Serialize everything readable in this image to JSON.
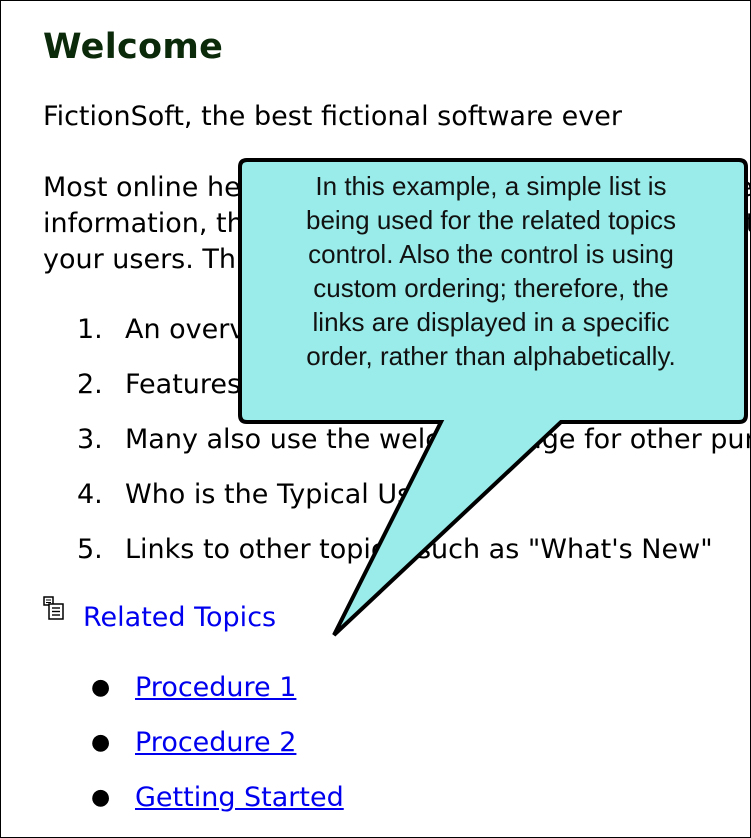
{
  "page": {
    "title": "Welcome",
    "intro": "FictionSoft, the best fictional software ever",
    "paragraph_lines": [
      "Most online help systems start with a welcome page with general",
      "information, that gives an overview of the documentation to",
      "your users. This is the page it might include:"
    ],
    "numbered_list": [
      {
        "num": "1.",
        "text": "An overview of the software and its features"
      },
      {
        "num": "2.",
        "text": "Features of this help system"
      },
      {
        "num": "3.",
        "text": "Many also use the welcome page for other purposes"
      },
      {
        "num": "4.",
        "text": "Who is the Typical User"
      },
      {
        "num": "5.",
        "text": "Links to other topics, such as \"What's New\""
      }
    ],
    "related_topics_label": "Related Topics",
    "related_links": [
      "Procedure 1",
      "Procedure 2",
      "Getting Started "
    ]
  },
  "callout": {
    "lines": [
      "In this example, a simple list is",
      "being used for the related topics",
      "control. Also the control is using",
      "custom ordering; therefore, the",
      "links are displayed in a specific",
      "order, rather than alphabetically."
    ],
    "fill_color": "#99ece9",
    "border_color": "#000000"
  },
  "icons": {
    "related_topics_icon": "related-topics-icon"
  }
}
